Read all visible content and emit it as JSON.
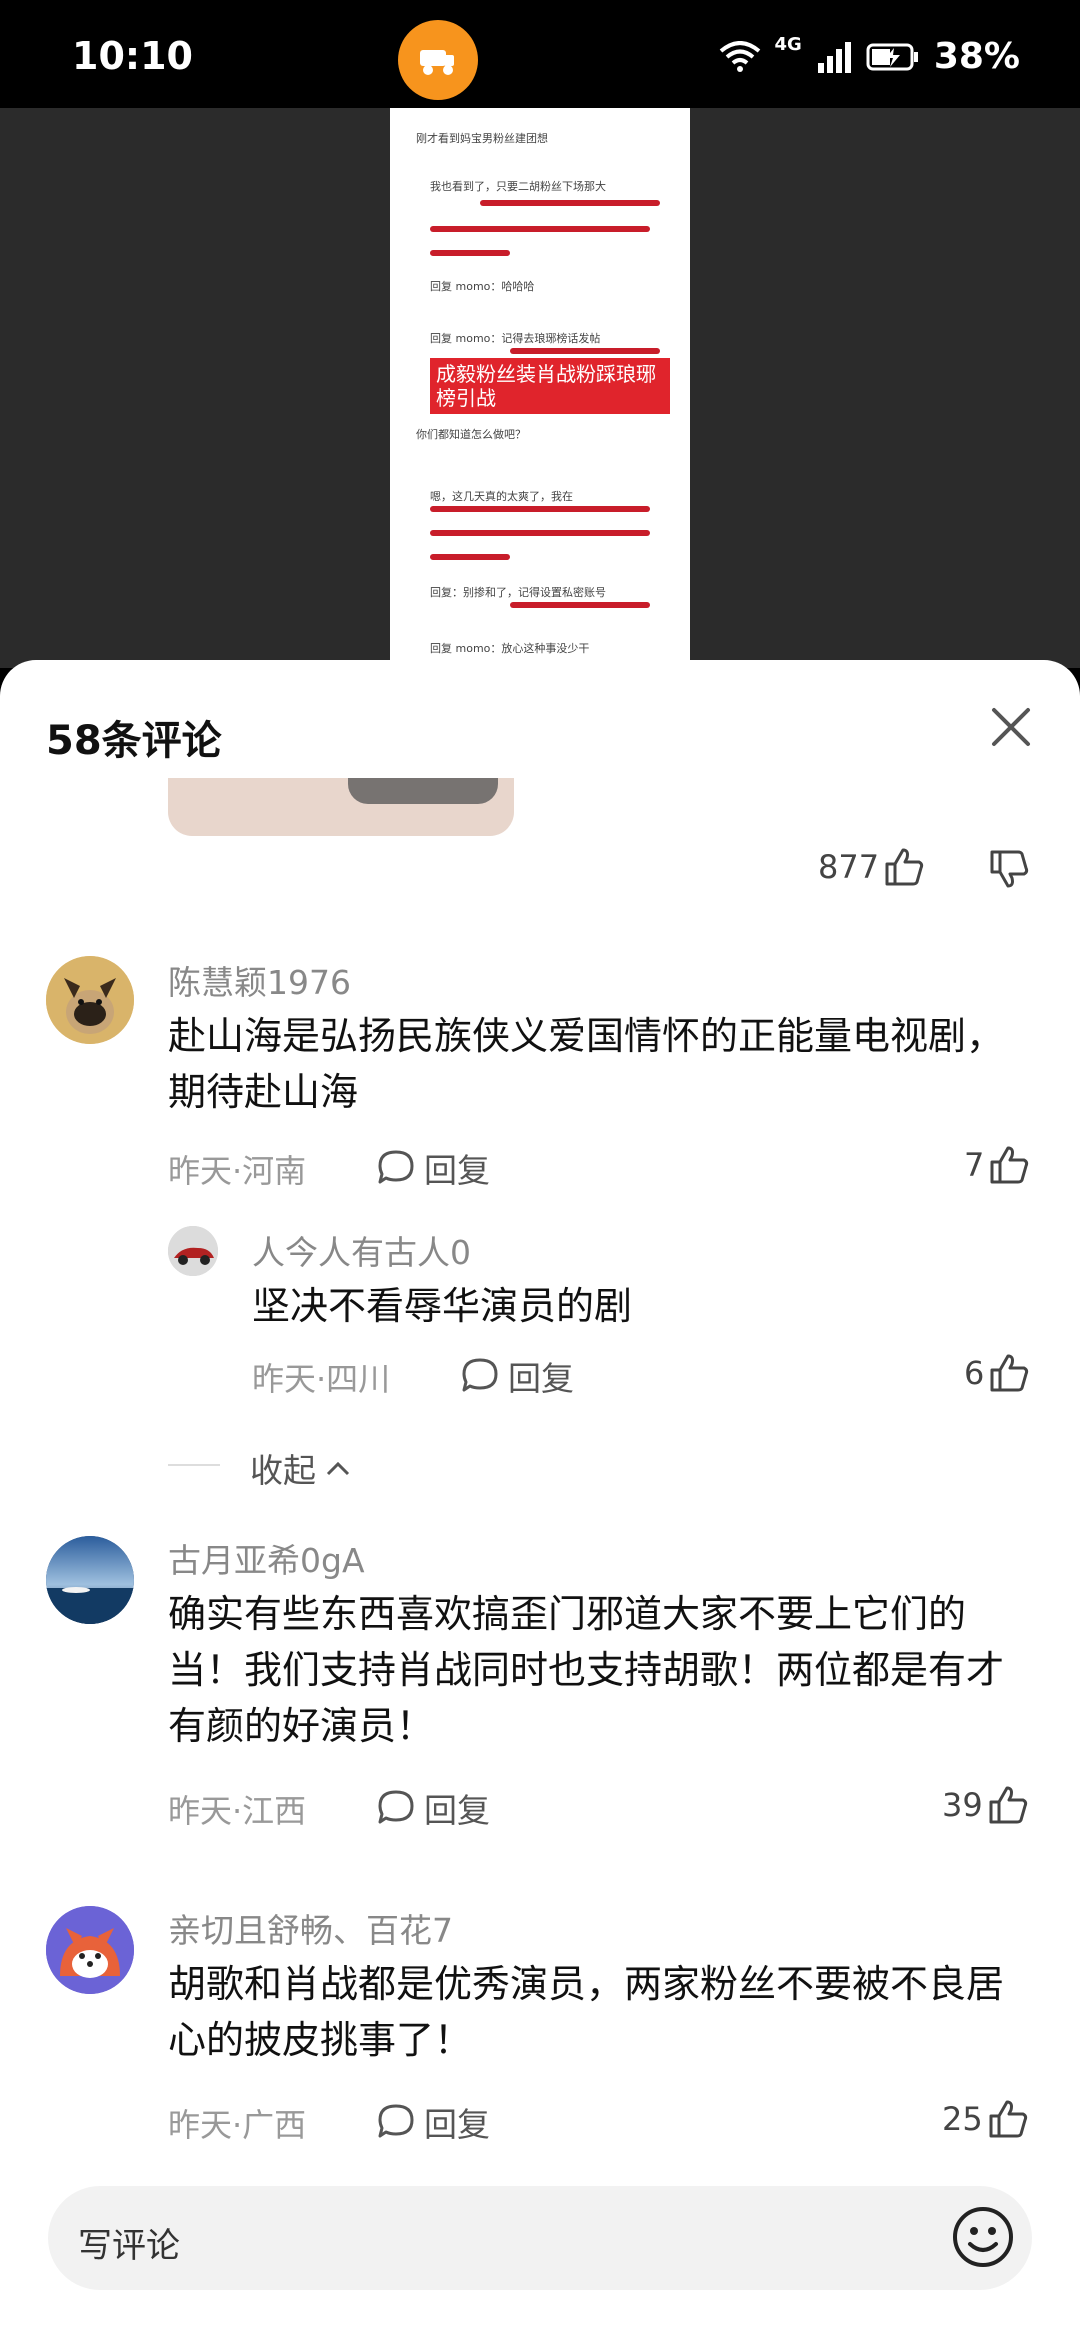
{
  "status": {
    "time": "10:10",
    "network": "4G",
    "battery": "38%"
  },
  "preview": {
    "banner": "成毅粉丝装肖战粉踩琅琊榜引战",
    "lines": [
      "刚才看到妈宝男粉丝建团想",
      "我也看到了，只要二胡粉丝下场那大",
      "回复 momo：哈哈哈",
      "回复 momo：记得去琅琊榜话发帖",
      "你们都知道怎么做吧？",
      "嗯，这几天真的太爽了，我在",
      "回复：别掺和了，记得设置私密账号",
      "回复 momo：放心这种事没少干"
    ]
  },
  "sheet": {
    "title": "58条评论",
    "top_likes": "877"
  },
  "comments": [
    {
      "user": "陈慧颖1976",
      "text": "赴山海是弘扬民族侠义爱国情怀的正能量电视剧，期待赴山海",
      "meta": "昨天·河南",
      "reply": "回复",
      "likes": "7"
    },
    {
      "user": "人今人有古人0",
      "text": "坚决不看辱华演员的剧",
      "meta": "昨天·四川",
      "reply": "回复",
      "likes": "6"
    },
    {
      "user": "古月亚希0gA",
      "text": "确实有些东西喜欢搞歪门邪道大家不要上它们的当！我们支持肖战同时也支持胡歌！两位都是有才有颜的好演员！",
      "meta": "昨天·江西",
      "reply": "回复",
      "likes": "39"
    },
    {
      "user": "亲切且舒畅、百花7",
      "text": "胡歌和肖战都是优秀演员，两家粉丝不要被不良居心的披皮挑事了！",
      "meta": "昨天·广西",
      "reply": "回复",
      "likes": "25"
    }
  ],
  "collapse_label": "收起",
  "input": {
    "placeholder": "写评论"
  }
}
